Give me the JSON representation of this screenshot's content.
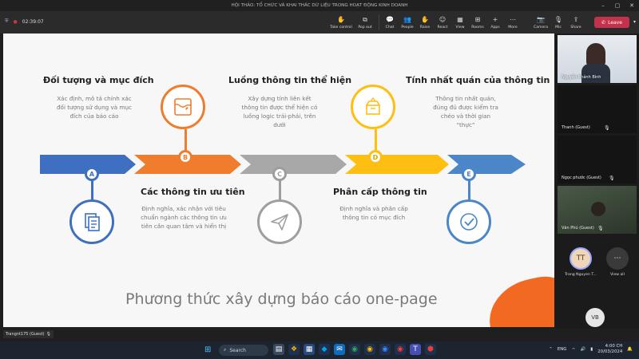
{
  "window": {
    "title": "HỘI THẢO: TỔ CHỨC VÀ KHAI THÁC DỮ LIỆU TRONG HOẠT ĐỘNG KINH DOANH",
    "minimize": "–",
    "maximize": "▢",
    "close": "✕"
  },
  "toolbar": {
    "shield": "⛨",
    "record_dot": "●",
    "timer": "02:39:07",
    "buttons": [
      {
        "label": "Take control",
        "icon": "✋"
      },
      {
        "label": "Pop out",
        "icon": "⧉"
      },
      {
        "label": "Chat",
        "icon": "💬"
      },
      {
        "label": "People",
        "icon": "👥"
      },
      {
        "label": "Raise",
        "icon": "✋"
      },
      {
        "label": "React",
        "icon": "☺"
      },
      {
        "label": "View",
        "icon": "▦"
      },
      {
        "label": "Rooms",
        "icon": "⊞"
      },
      {
        "label": "Apps",
        "icon": "+"
      },
      {
        "label": "More",
        "icon": "⋯"
      }
    ],
    "media": [
      {
        "label": "Camera",
        "icon": "📷"
      },
      {
        "label": "Mic",
        "icon": "🎙"
      },
      {
        "label": "Share",
        "icon": "⇪"
      }
    ],
    "leave": "Leave",
    "leave_icon": "✆",
    "leave_caret": "▾"
  },
  "slide": {
    "items": [
      {
        "letter": "A",
        "title": "Đối tượng và mục đích",
        "desc": "Xác định, mô tả chính xác đối tượng sử dụng và mục đích của báo cáo",
        "color": "#3f6fc1",
        "icon": "document-icon"
      },
      {
        "letter": "B",
        "title": "Các thông tin ưu tiên",
        "desc": "Định nghĩa, xác nhận với tiêu chuẩn ngành các thông tin ưu tiên cần quan tâm và hiển thị",
        "color": "#ef7d2d",
        "icon": "map-icon"
      },
      {
        "letter": "C",
        "title": "Luồng thông tin thể hiện",
        "desc": "Xây dựng tính liên kết thông tin được thể hiện có luồng logic trái-phải, trên dưới",
        "color": "#9e9e9e",
        "icon": "paper-plane-icon"
      },
      {
        "letter": "D",
        "title": "Phân cấp thông tin",
        "desc": "Định nghĩa và phân cấp thông tin có mục đích",
        "color": "#ffbe12",
        "icon": "box-icon"
      },
      {
        "letter": "E",
        "title": "Tính nhất quán của thông tin",
        "desc": "Thông tin nhất quán, đúng đủ được kiểm tra chéo và thời gian “thực”",
        "color": "#4b86c8",
        "icon": "check-icon"
      }
    ],
    "footer_title": "Phương thức xây dựng báo cáo one-page",
    "presenter_tag": "Trangnt175 (Guest)",
    "presenter_mic": "🎙"
  },
  "participants": [
    {
      "name": "Nguyễn Khánh Bình",
      "type": "video",
      "mic": ""
    },
    {
      "name": "Thanh (Guest)",
      "type": "dark",
      "mic": "🎙"
    },
    {
      "name": "Ngọc phước (Guest)",
      "type": "dark",
      "mic": "🎙"
    },
    {
      "name": "Văn Phú (Guest)",
      "type": "video",
      "mic": "🎙"
    }
  ],
  "avatars": [
    {
      "initials": "TT",
      "name": "Trang Nguyen T..."
    },
    {
      "initials": "⋯",
      "name": "View all"
    },
    {
      "initials": "VB",
      "name": ""
    }
  ],
  "taskbar": {
    "start": "⊞",
    "search_icon": "⌕",
    "search": "Search",
    "apps": [
      {
        "glyph": "▤",
        "bg": "#3a4a5e",
        "fg": "#fff"
      },
      {
        "glyph": "❖",
        "bg": "#1e3050",
        "fg": "#ffb900"
      },
      {
        "glyph": "▦",
        "bg": "#264a7e",
        "fg": "#fff"
      },
      {
        "glyph": "◆",
        "bg": "#1e3050",
        "fg": "#00a4ef"
      },
      {
        "glyph": "✉",
        "bg": "#0f6cbd",
        "fg": "#fff"
      },
      {
        "glyph": "◉",
        "bg": "#1e3050",
        "fg": "#34a853"
      },
      {
        "glyph": "◉",
        "bg": "#1e3050",
        "fg": "#fbbc05"
      },
      {
        "glyph": "◉",
        "bg": "#1e3050",
        "fg": "#4285f4"
      },
      {
        "glyph": "◉",
        "bg": "#1e3050",
        "fg": "#ea4335"
      },
      {
        "glyph": "T",
        "bg": "#464eb8",
        "fg": "#fff"
      },
      {
        "glyph": "⬢",
        "bg": "#1e3050",
        "fg": "#e0433a"
      }
    ],
    "tray": {
      "chevron": "⌃",
      "lang": "ENG",
      "wifi": "⌔",
      "volume": "🔊",
      "battery": "▮",
      "time": "4:00 CH",
      "date": "20/03/2024",
      "notify": "🔔"
    }
  },
  "colors": {
    "accent": "#c4314b",
    "slide_bg": "#f7f7f7",
    "orange_blob": "#f26a21"
  }
}
